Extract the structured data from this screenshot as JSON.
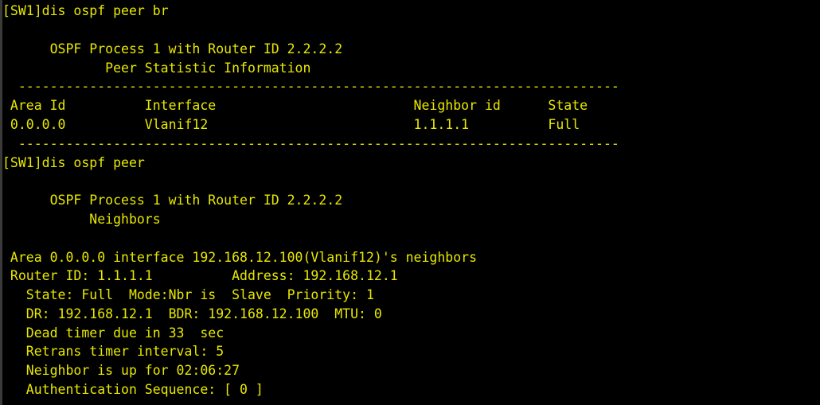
{
  "terminal": {
    "text_color": "#e8e800",
    "background": "#000000",
    "lines": [
      "[SW1]dis ospf peer br",
      "",
      "      OSPF Process 1 with Router ID 2.2.2.2",
      "             Peer Statistic Information",
      "  ----------------------------------------------------------------------------",
      " Area Id          Interface                         Neighbor id      State",
      " 0.0.0.0          Vlanif12                          1.1.1.1          Full",
      "  ----------------------------------------------------------------------------",
      "[SW1]dis ospf peer",
      "",
      "      OSPF Process 1 with Router ID 2.2.2.2",
      "           Neighbors",
      "",
      " Area 0.0.0.0 interface 192.168.12.100(Vlanif12)'s neighbors",
      " Router ID: 1.1.1.1          Address: 192.168.12.1",
      "   State: Full  Mode:Nbr is  Slave  Priority: 1",
      "   DR: 192.168.12.1  BDR: 192.168.12.100  MTU: 0",
      "   Dead timer due in 33  sec",
      "   Retrans timer interval: 5",
      "   Neighbor is up for 02:06:27",
      "   Authentication Sequence: [ 0 ]"
    ]
  }
}
